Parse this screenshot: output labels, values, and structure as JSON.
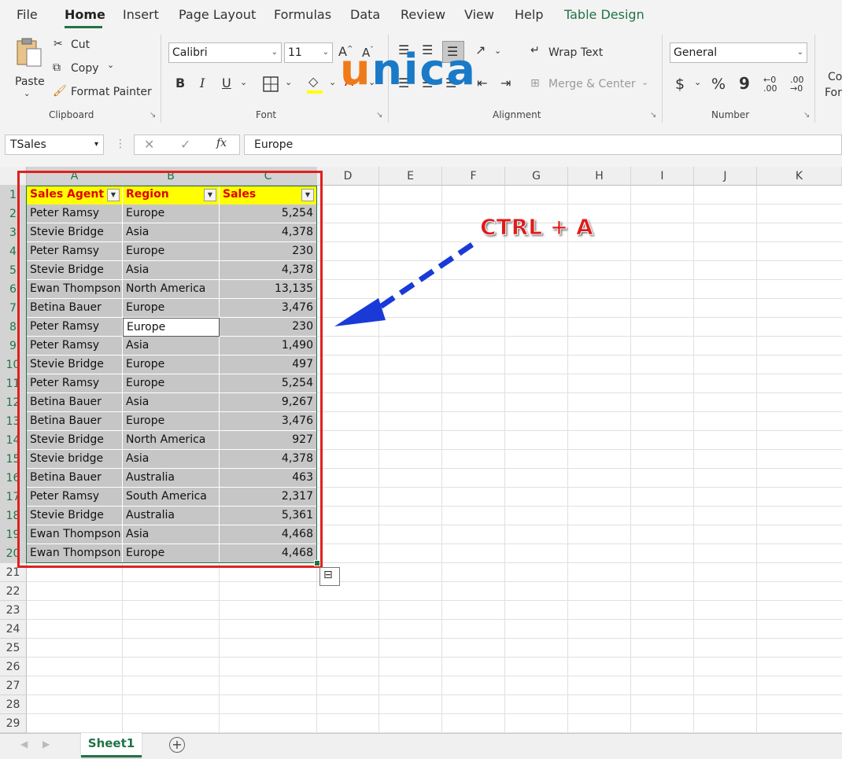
{
  "menu": {
    "tabs": [
      "File",
      "Home",
      "Insert",
      "Page Layout",
      "Formulas",
      "Data",
      "Review",
      "View",
      "Help",
      "Table Design"
    ],
    "active": "Home"
  },
  "ribbon": {
    "clipboard": {
      "paste": "Paste",
      "cut": "Cut",
      "copy": "Copy",
      "format_painter": "Format Painter",
      "label": "Clipboard"
    },
    "font": {
      "name": "Calibri",
      "size": "11",
      "bold": "B",
      "italic": "I",
      "underline": "U",
      "label": "Font"
    },
    "alignment": {
      "wrap_text": "Wrap Text",
      "merge_center": "Merge & Center",
      "label": "Alignment"
    },
    "number": {
      "format": "General",
      "currency": "$",
      "percent": "%",
      "comma": "9",
      "label": "Number"
    },
    "overflow": {
      "line1": "Co",
      "line2": "For"
    }
  },
  "logo": {
    "text": "unica",
    "color_u": "#f07a1a",
    "color_rest": "#1a7ac8"
  },
  "formula_bar": {
    "name_box": "TSales",
    "fx": "fx",
    "value": "Europe"
  },
  "annotation": {
    "label": "CTRL + A",
    "label_color": "#e01a1a",
    "arrow_color": "#1a3ad8",
    "box_color": "#e02020"
  },
  "sheet": {
    "columns": [
      "A",
      "B",
      "C",
      "D",
      "E",
      "F",
      "G",
      "H",
      "I",
      "J",
      "K"
    ],
    "rows": [
      "1",
      "2",
      "3",
      "4",
      "5",
      "6",
      "7",
      "8",
      "9",
      "10",
      "11",
      "12",
      "13",
      "14",
      "15",
      "16",
      "17",
      "18",
      "19",
      "20",
      "21",
      "22",
      "23",
      "24",
      "25",
      "26",
      "27",
      "28",
      "29"
    ],
    "headers": [
      "Sales Agent",
      "Region",
      "Sales"
    ],
    "data": [
      [
        "Peter Ramsy",
        "Europe",
        "5,254"
      ],
      [
        "Stevie Bridge",
        "Asia",
        "4,378"
      ],
      [
        "Peter Ramsy",
        "Europe",
        "230"
      ],
      [
        "Stevie Bridge",
        "Asia",
        "4,378"
      ],
      [
        "Ewan Thompson",
        "North America",
        "13,135"
      ],
      [
        "Betina Bauer",
        "Europe",
        "3,476"
      ],
      [
        "Peter Ramsy",
        "Europe",
        "230"
      ],
      [
        "Peter Ramsy",
        "Asia",
        "1,490"
      ],
      [
        "Stevie Bridge",
        "Europe",
        "497"
      ],
      [
        "Peter Ramsy",
        "Europe",
        "5,254"
      ],
      [
        "Betina Bauer",
        "Asia",
        "9,267"
      ],
      [
        "Betina Bauer",
        "Europe",
        "3,476"
      ],
      [
        "Stevie Bridge",
        "North America",
        "927"
      ],
      [
        "Stevie bridge",
        "Asia",
        "4,378"
      ],
      [
        "Betina Bauer",
        "Australia",
        "463"
      ],
      [
        "Peter Ramsy",
        "South America",
        "2,317"
      ],
      [
        "Stevie Bridge",
        "Australia",
        "5,361"
      ],
      [
        "Ewan Thompson",
        "Asia",
        "4,468"
      ],
      [
        "Ewan Thompson",
        "Europe",
        "4,468"
      ]
    ],
    "active_cell": "B8",
    "tab": "Sheet1",
    "add_sheet": "+"
  },
  "colors": {
    "accent": "#217346",
    "header_fill": "#ffff00",
    "header_text": "#e00000",
    "selection": "#c6c6c6"
  }
}
